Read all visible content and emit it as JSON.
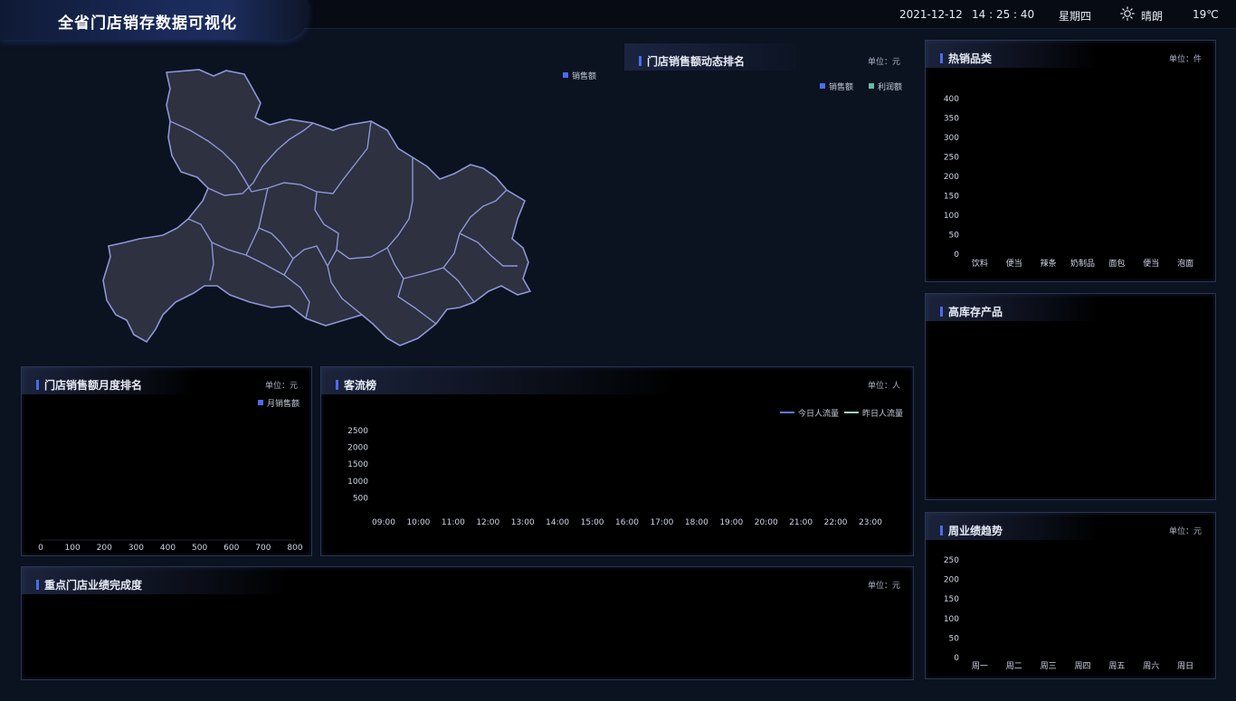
{
  "header": {
    "app_title": "全省门店销存数据可视化",
    "date": "2021-12-12",
    "time": "14 : 25 : 40",
    "weekday": "星期四",
    "weather_icon": "sun-icon",
    "weather": "晴朗",
    "temperature": "19℃"
  },
  "map_section": {
    "legend_label": "销售额",
    "legend_color": "#4a6cf0"
  },
  "dynamic_rank": {
    "title": "门店销售额动态排名",
    "unit": "单位：元",
    "legend": [
      {
        "label": "销售额",
        "color": "#4a6cf0"
      },
      {
        "label": "利润额",
        "color": "#5bc0a6"
      }
    ]
  },
  "hot_categories": {
    "title": "热销品类",
    "unit": "单位：件"
  },
  "high_stock": {
    "title": "高库存产品"
  },
  "weekly_trend": {
    "title": "周业绩趋势",
    "unit": "单位：元"
  },
  "monthly_rank": {
    "title": "门店销售额月度排名",
    "unit": "单位：元",
    "legend_label": "月销售额",
    "legend_color": "#4a6cf0"
  },
  "traffic": {
    "title": "客流榜",
    "unit": "单位：人",
    "legend": [
      {
        "label": "今日人流量",
        "color": "#5b7cf5"
      },
      {
        "label": "昨日人流量",
        "color": "#9fd8c2"
      }
    ]
  },
  "key_stores": {
    "title": "重点门店业绩完成度",
    "unit": "单位：元"
  },
  "chart_data": [
    {
      "id": "hot_categories",
      "type": "bar",
      "categories": [
        "饮料",
        "便当",
        "辣条",
        "奶制品",
        "面包",
        "便当",
        "泡面"
      ],
      "series": [],
      "ylim": [
        0,
        400
      ],
      "yticks": [
        0,
        50,
        100,
        150,
        200,
        250,
        300,
        350,
        400
      ],
      "grid": false
    },
    {
      "id": "weekly_trend",
      "type": "bar",
      "categories": [
        "周一",
        "周二",
        "周三",
        "周四",
        "周五",
        "周六",
        "周日"
      ],
      "series": [],
      "ylim": [
        0,
        250
      ],
      "yticks": [
        0,
        50,
        100,
        150,
        200,
        250
      ],
      "grid": false
    },
    {
      "id": "monthly_rank",
      "type": "bar",
      "orientation": "horizontal",
      "series": [],
      "xlim": [
        0,
        800
      ],
      "xticks": [
        0,
        100,
        200,
        300,
        400,
        500,
        600,
        700,
        800
      ],
      "grid": false
    },
    {
      "id": "traffic",
      "type": "line",
      "x": [
        "09:00",
        "10:00",
        "11:00",
        "12:00",
        "13:00",
        "14:00",
        "15:00",
        "16:00",
        "17:00",
        "18:00",
        "19:00",
        "20:00",
        "21:00",
        "22:00",
        "23:00"
      ],
      "series": [],
      "ylim": [
        0,
        2500
      ],
      "yticks": [
        500,
        1000,
        1500,
        2000,
        2500
      ],
      "grid": false
    }
  ]
}
